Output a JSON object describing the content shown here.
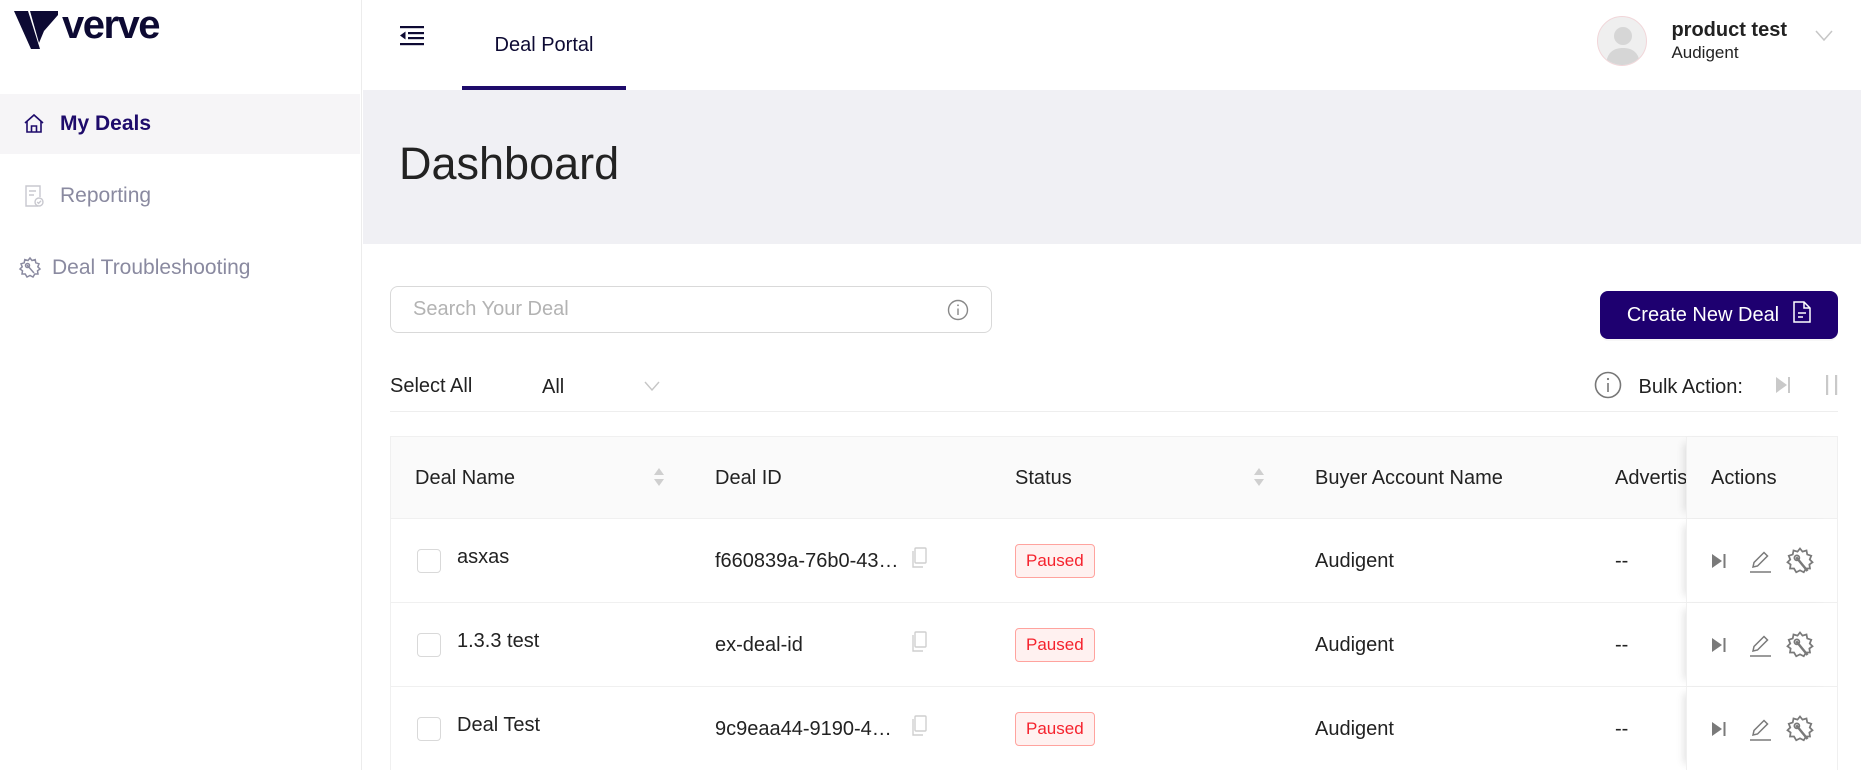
{
  "brand": {
    "name": "verve",
    "primary_color": "#1e0070",
    "logo_color": "#0d0a33"
  },
  "sidebar": {
    "items": [
      {
        "label": "My Deals",
        "icon": "home-icon",
        "active": true
      },
      {
        "label": "Reporting",
        "icon": "report-icon",
        "active": false
      },
      {
        "label": "Deal Troubleshooting",
        "icon": "gear-wrench-icon",
        "active": false
      }
    ]
  },
  "topbar": {
    "menu_icon": "menu-collapse-icon",
    "tabs": [
      {
        "label": "Deal Portal",
        "active": true
      }
    ],
    "user": {
      "name": "product test",
      "organization": "Audigent",
      "avatar_icon": "user-avatar-icon"
    }
  },
  "page": {
    "title": "Dashboard"
  },
  "toolbar": {
    "search_placeholder": "Search Your Deal",
    "search_value": "",
    "create_button_label": "Create New Deal",
    "select_all_label": "Select All",
    "filter_value": "All",
    "bulk_action_label": "Bulk Action:"
  },
  "table": {
    "columns": [
      {
        "label": "Deal Name",
        "sortable": true
      },
      {
        "label": "Deal ID",
        "sortable": false
      },
      {
        "label": "Status",
        "sortable": true
      },
      {
        "label": "Buyer Account Name",
        "sortable": false
      },
      {
        "label": "Advertis",
        "sortable": false
      },
      {
        "label": "Actions",
        "sortable": false
      }
    ],
    "rows": [
      {
        "deal_name": "asxas",
        "deal_id": "f660839a-76b0-43…",
        "status": "Paused",
        "buyer_account": "Audigent",
        "advertiser": "--"
      },
      {
        "deal_name": "1.3.3 test",
        "deal_id": "ex-deal-id",
        "status": "Paused",
        "buyer_account": "Audigent",
        "advertiser": "--"
      },
      {
        "deal_name": "Deal Test",
        "deal_id": "9c9eaa44-9190-4…",
        "status": "Paused",
        "buyer_account": "Audigent",
        "advertiser": "--"
      }
    ]
  },
  "colors": {
    "status_paused_text": "#f5222d",
    "status_paused_bg": "#fff1f0",
    "status_paused_border": "#ffa39e",
    "band_bg": "#f0f0f4"
  }
}
